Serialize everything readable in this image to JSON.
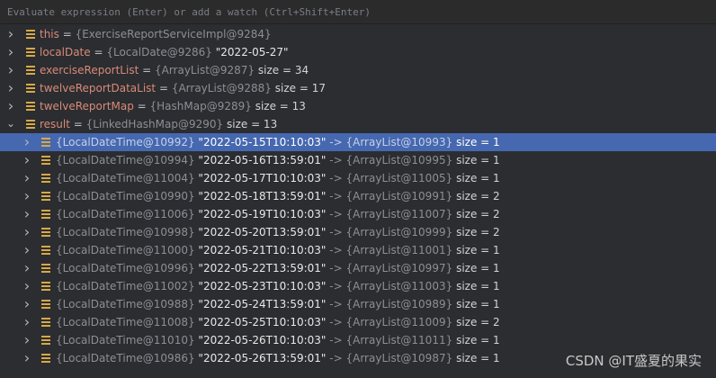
{
  "eval_bar": {
    "placeholder": "Evaluate expression (Enter) or add a watch (Ctrl+Shift+Enter)"
  },
  "variables": [
    {
      "name": "this",
      "ref": "{ExerciseReportServiceImpl@9284}",
      "value": "",
      "size": ""
    },
    {
      "name": "localDate",
      "ref": "{LocalDate@9286}",
      "value": "\"2022-05-27\"",
      "size": ""
    },
    {
      "name": "exerciseReportList",
      "ref": "{ArrayList@9287}",
      "value": "",
      "size": "size = 34"
    },
    {
      "name": "twelveReportDataList",
      "ref": "{ArrayList@9288}",
      "value": "",
      "size": "size = 17"
    },
    {
      "name": "twelveReportMap",
      "ref": "{HashMap@9289}",
      "value": "",
      "size": "size = 13"
    },
    {
      "name": "result",
      "ref": "{LinkedHashMap@9290}",
      "value": "",
      "size": "size = 13"
    }
  ],
  "entries": [
    {
      "key": "{LocalDateTime@10992}",
      "key_str": "\"2022-05-15T10:10:03\"",
      "arrow": "->",
      "val": "{ArrayList@10993}",
      "size": "size = 1"
    },
    {
      "key": "{LocalDateTime@10994}",
      "key_str": "\"2022-05-16T13:59:01\"",
      "arrow": "->",
      "val": "{ArrayList@10995}",
      "size": "size = 1"
    },
    {
      "key": "{LocalDateTime@11004}",
      "key_str": "\"2022-05-17T10:10:03\"",
      "arrow": "->",
      "val": "{ArrayList@11005}",
      "size": "size = 1"
    },
    {
      "key": "{LocalDateTime@10990}",
      "key_str": "\"2022-05-18T13:59:01\"",
      "arrow": "->",
      "val": "{ArrayList@10991}",
      "size": "size = 2"
    },
    {
      "key": "{LocalDateTime@11006}",
      "key_str": "\"2022-05-19T10:10:03\"",
      "arrow": "->",
      "val": "{ArrayList@11007}",
      "size": "size = 2"
    },
    {
      "key": "{LocalDateTime@10998}",
      "key_str": "\"2022-05-20T13:59:01\"",
      "arrow": "->",
      "val": "{ArrayList@10999}",
      "size": "size = 2"
    },
    {
      "key": "{LocalDateTime@11000}",
      "key_str": "\"2022-05-21T10:10:03\"",
      "arrow": "->",
      "val": "{ArrayList@11001}",
      "size": "size = 1"
    },
    {
      "key": "{LocalDateTime@10996}",
      "key_str": "\"2022-05-22T13:59:01\"",
      "arrow": "->",
      "val": "{ArrayList@10997}",
      "size": "size = 1"
    },
    {
      "key": "{LocalDateTime@11002}",
      "key_str": "\"2022-05-23T10:10:03\"",
      "arrow": "->",
      "val": "{ArrayList@11003}",
      "size": "size = 1"
    },
    {
      "key": "{LocalDateTime@10988}",
      "key_str": "\"2022-05-24T13:59:01\"",
      "arrow": "->",
      "val": "{ArrayList@10989}",
      "size": "size = 1"
    },
    {
      "key": "{LocalDateTime@11008}",
      "key_str": "\"2022-05-25T10:10:03\"",
      "arrow": "->",
      "val": "{ArrayList@11009}",
      "size": "size = 2"
    },
    {
      "key": "{LocalDateTime@11010}",
      "key_str": "\"2022-05-26T10:10:03\"",
      "arrow": "->",
      "val": "{ArrayList@11011}",
      "size": "size = 1"
    },
    {
      "key": "{LocalDateTime@10986}",
      "key_str": "\"2022-05-26T13:59:01\"",
      "arrow": "->",
      "val": "{ArrayList@10987}",
      "size": "size = 1"
    }
  ],
  "watermark": "CSDN @IT盛夏的果实",
  "colors": {
    "background": "#2b2d30",
    "selection": "#4668b0",
    "variable_name": "#d98a7a",
    "field_icon": "#d8a946"
  },
  "icons": {
    "collapsed": "chevron-right-icon",
    "expanded": "chevron-down-icon",
    "field": "field-icon"
  }
}
